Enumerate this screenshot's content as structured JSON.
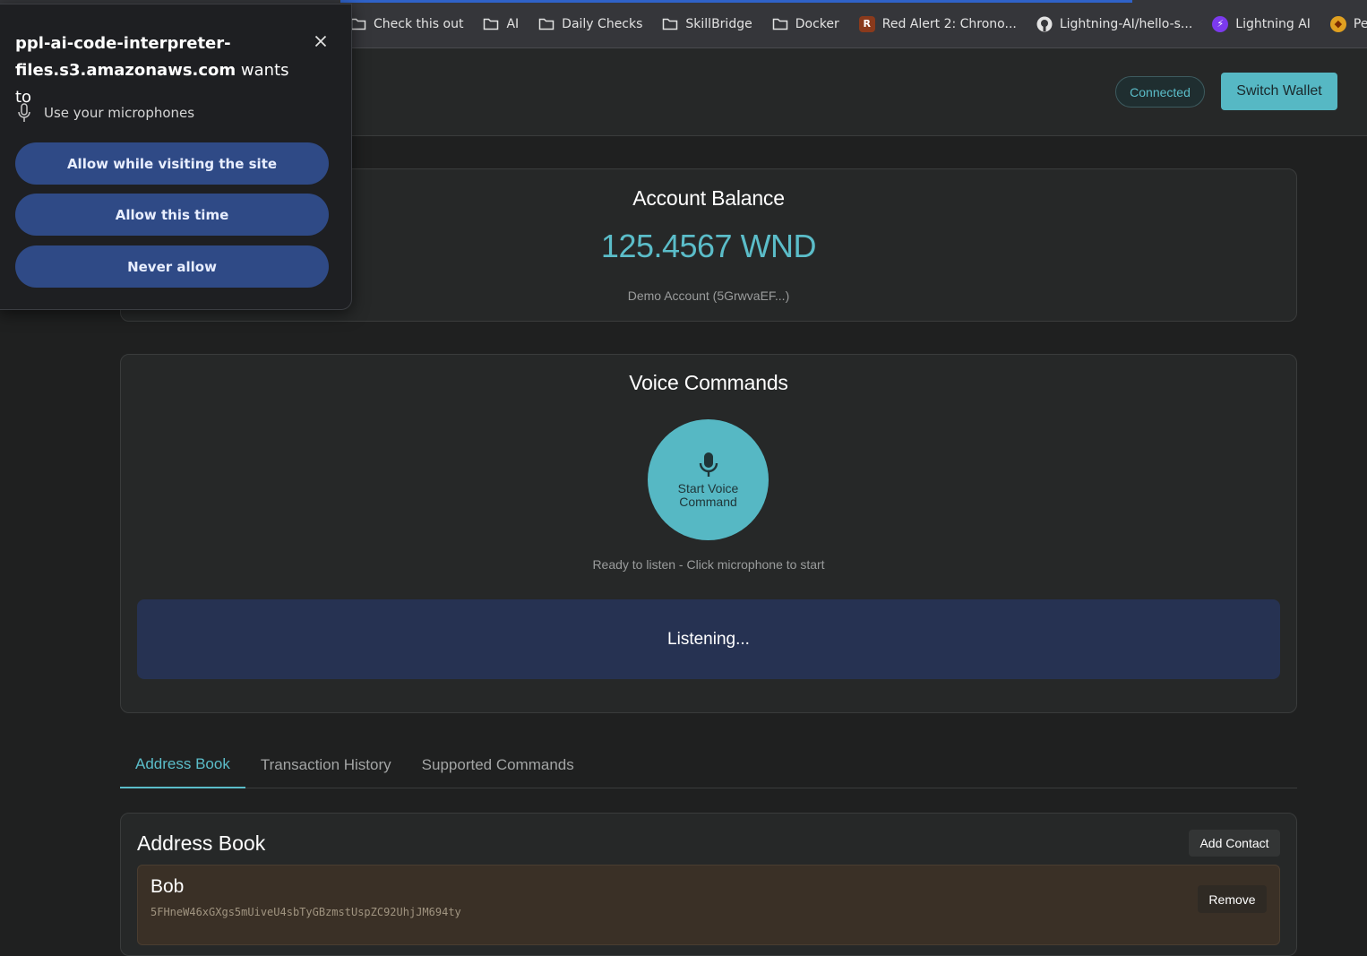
{
  "bookmarks": [
    {
      "label": "Check this out",
      "icon": "folder-icon"
    },
    {
      "label": "AI",
      "icon": "folder-icon"
    },
    {
      "label": "Daily Checks",
      "icon": "folder-icon"
    },
    {
      "label": "SkillBridge",
      "icon": "folder-icon"
    },
    {
      "label": "Docker",
      "icon": "folder-icon"
    },
    {
      "label": "Red Alert 2: Chrono...",
      "icon": "red-alert-favicon"
    },
    {
      "label": "Lightning-AI/hello-s...",
      "icon": "github-icon"
    },
    {
      "label": "Lightning AI",
      "icon": "lightning-icon"
    },
    {
      "label": "Perp",
      "icon": "perp-favicon"
    }
  ],
  "header": {
    "status_badge": "Connected",
    "switch_wallet_label": "Switch Wallet"
  },
  "balance": {
    "title": "Account Balance",
    "value": "125.4567 WND",
    "account": "Demo Account (5GrwvaEF...)"
  },
  "voice": {
    "title": "Voice Commands",
    "mic_button_label": "Start Voice Command",
    "status": "Ready to listen - Click microphone to start",
    "listening_text": "Listening..."
  },
  "tabs": [
    {
      "label": "Address Book",
      "active": true
    },
    {
      "label": "Transaction History",
      "active": false
    },
    {
      "label": "Supported Commands",
      "active": false
    }
  ],
  "address_book": {
    "title": "Address Book",
    "add_contact_label": "Add Contact",
    "contacts": [
      {
        "name": "Bob",
        "address": "5FHneW46xGXgs5mUiveU4sbTyGBzmstUspZC92UhjJM694ty",
        "remove_label": "Remove"
      }
    ]
  },
  "permission_popup": {
    "site": "ppl-ai-code-interpreter-files.s3.amazonaws.com",
    "wants_to": " wants to",
    "permission": "Use your microphones",
    "allow_visiting": "Allow while visiting the site",
    "allow_once": "Allow this time",
    "never_allow": "Never allow"
  },
  "colors": {
    "accent": "#56b8c4",
    "background": "#1f2020",
    "card": "#262828",
    "listening_bg": "#263252",
    "popup_button": "#2f4a86"
  }
}
